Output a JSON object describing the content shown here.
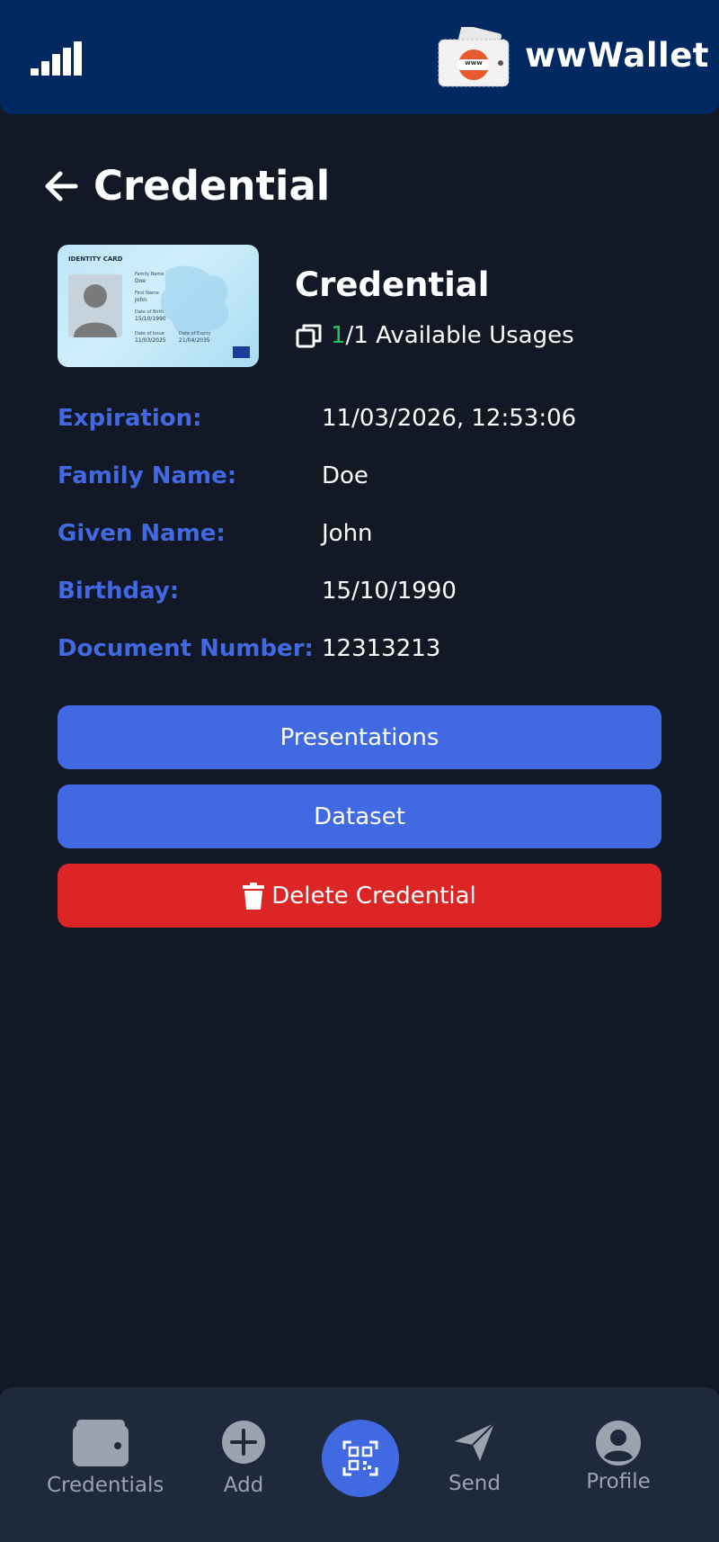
{
  "header": {
    "brand": "wwWallet",
    "logo_text": "www",
    "signal_icon": "signal-bars-icon",
    "wallet_icon": "wallet-logo-icon"
  },
  "page": {
    "title": "Credential",
    "back_icon": "arrow-left-icon"
  },
  "card": {
    "title": "IDENTITY CARD",
    "family_name_label": "Family Name",
    "family_name": "Doe",
    "first_name_label": "First Name",
    "first_name": "John",
    "dob_label": "Date of Birth",
    "dob": "15/10/1990",
    "issue_label": "Date of Issue",
    "issue": "11/03/2025",
    "expiry_label": "Date of Expiry",
    "expiry": "21/04/2035"
  },
  "credential": {
    "name": "Credential",
    "usages_available": "1",
    "usages_rest": "/1 Available Usages",
    "usages_icon": "copy-icon"
  },
  "details": [
    {
      "label": "Expiration:",
      "value": "11/03/2026, 12:53:06"
    },
    {
      "label": "Family Name:",
      "value": "Doe"
    },
    {
      "label": "Given Name:",
      "value": "John"
    },
    {
      "label": "Birthday:",
      "value": "15/10/1990"
    },
    {
      "label": "Document Number:",
      "value": "12313213"
    }
  ],
  "actions": {
    "presentations": "Presentations",
    "dataset": "Dataset",
    "delete": "Delete Credential"
  },
  "nav": {
    "credentials": "Credentials",
    "add": "Add",
    "send": "Send",
    "profile": "Profile"
  },
  "colors": {
    "background": "#121826",
    "header": "#002961",
    "accent": "#4169e1",
    "danger": "#dc2626",
    "available": "#22c55e",
    "nav_bg": "#1e293b",
    "nav_text": "#9ca3af"
  }
}
